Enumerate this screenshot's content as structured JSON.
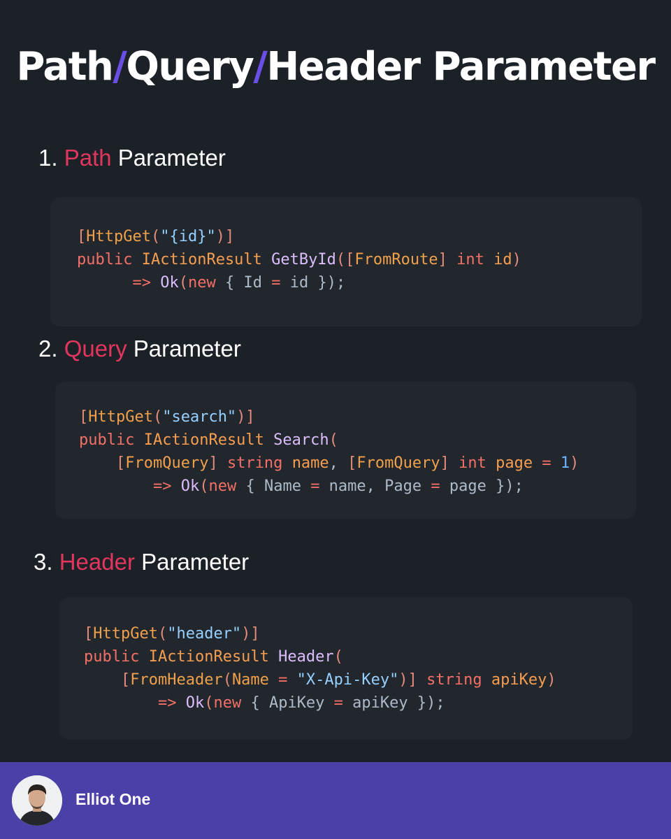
{
  "title": {
    "part1": "Path",
    "sep1": "/",
    "part2": "Query",
    "sep2": "/",
    "part3": "Header Parameter"
  },
  "sections": [
    {
      "number": "1.",
      "keyword": "Path",
      "rest": "Parameter",
      "code": [
        [
          [
            "bracket",
            "["
          ],
          [
            "attr",
            "HttpGet"
          ],
          [
            "bracket",
            "("
          ],
          [
            "str",
            "\"{id}\""
          ],
          [
            "bracket",
            ")]"
          ]
        ],
        [
          [
            "kw",
            "public"
          ],
          [
            "plain",
            " "
          ],
          [
            "type",
            "IActionResult"
          ],
          [
            "plain",
            " "
          ],
          [
            "fn",
            "GetById"
          ],
          [
            "bracket",
            "(["
          ],
          [
            "attr",
            "FromRoute"
          ],
          [
            "bracket",
            "]"
          ],
          [
            "plain",
            " "
          ],
          [
            "kw",
            "int"
          ],
          [
            "plain",
            " "
          ],
          [
            "type",
            "id"
          ],
          [
            "bracket",
            ")"
          ]
        ],
        [
          [
            "plain",
            "      "
          ],
          [
            "kw",
            "=>"
          ],
          [
            "plain",
            " "
          ],
          [
            "fn",
            "Ok"
          ],
          [
            "bracket",
            "("
          ],
          [
            "kw",
            "new"
          ],
          [
            "plain",
            " { Id "
          ],
          [
            "kw",
            "="
          ],
          [
            "plain",
            " id });"
          ]
        ]
      ]
    },
    {
      "number": "2.",
      "keyword": "Query",
      "rest": "Parameter",
      "code": [
        [
          [
            "bracket",
            "["
          ],
          [
            "attr",
            "HttpGet"
          ],
          [
            "bracket",
            "("
          ],
          [
            "str",
            "\"search\""
          ],
          [
            "bracket",
            ")]"
          ]
        ],
        [
          [
            "kw",
            "public"
          ],
          [
            "plain",
            " "
          ],
          [
            "type",
            "IActionResult"
          ],
          [
            "plain",
            " "
          ],
          [
            "fn",
            "Search"
          ],
          [
            "bracket",
            "("
          ]
        ],
        [
          [
            "plain",
            "    "
          ],
          [
            "bracket",
            "["
          ],
          [
            "attr",
            "FromQuery"
          ],
          [
            "bracket",
            "]"
          ],
          [
            "plain",
            " "
          ],
          [
            "kw",
            "string"
          ],
          [
            "plain",
            " "
          ],
          [
            "type",
            "name"
          ],
          [
            "plain",
            ", "
          ],
          [
            "bracket",
            "["
          ],
          [
            "attr",
            "FromQuery"
          ],
          [
            "bracket",
            "]"
          ],
          [
            "plain",
            " "
          ],
          [
            "kw",
            "int"
          ],
          [
            "plain",
            " "
          ],
          [
            "type",
            "page"
          ],
          [
            "plain",
            " "
          ],
          [
            "kw",
            "="
          ],
          [
            "plain",
            " "
          ],
          [
            "num",
            "1"
          ],
          [
            "bracket",
            ")"
          ]
        ],
        [
          [
            "plain",
            "        "
          ],
          [
            "kw",
            "=>"
          ],
          [
            "plain",
            " "
          ],
          [
            "fn",
            "Ok"
          ],
          [
            "bracket",
            "("
          ],
          [
            "kw",
            "new"
          ],
          [
            "plain",
            " { Name "
          ],
          [
            "kw",
            "="
          ],
          [
            "plain",
            " name, Page "
          ],
          [
            "kw",
            "="
          ],
          [
            "plain",
            " page });"
          ]
        ]
      ]
    },
    {
      "number": "3.",
      "keyword": "Header",
      "rest": "Parameter",
      "code": [
        [
          [
            "bracket",
            "["
          ],
          [
            "attr",
            "HttpGet"
          ],
          [
            "bracket",
            "("
          ],
          [
            "str",
            "\"header\""
          ],
          [
            "bracket",
            ")]"
          ]
        ],
        [
          [
            "kw",
            "public"
          ],
          [
            "plain",
            " "
          ],
          [
            "type",
            "IActionResult"
          ],
          [
            "plain",
            " "
          ],
          [
            "fn",
            "Header"
          ],
          [
            "bracket",
            "("
          ]
        ],
        [
          [
            "plain",
            "    "
          ],
          [
            "bracket",
            "["
          ],
          [
            "attr",
            "FromHeader"
          ],
          [
            "bracket",
            "("
          ],
          [
            "attr",
            "Name"
          ],
          [
            "plain",
            " "
          ],
          [
            "kw",
            "="
          ],
          [
            "plain",
            " "
          ],
          [
            "str",
            "\"X-Api-Key\""
          ],
          [
            "bracket",
            ")]"
          ],
          [
            "plain",
            " "
          ],
          [
            "kw",
            "string"
          ],
          [
            "plain",
            " "
          ],
          [
            "type",
            "apiKey"
          ],
          [
            "bracket",
            ")"
          ]
        ],
        [
          [
            "plain",
            "        "
          ],
          [
            "kw",
            "=>"
          ],
          [
            "plain",
            " "
          ],
          [
            "fn",
            "Ok"
          ],
          [
            "bracket",
            "("
          ],
          [
            "kw",
            "new"
          ],
          [
            "plain",
            " { ApiKey "
          ],
          [
            "kw",
            "="
          ],
          [
            "plain",
            " apiKey });"
          ]
        ]
      ]
    }
  ],
  "footer": {
    "author": "Elliot One",
    "avatar_icon": "author-avatar"
  },
  "colors": {
    "background": "#1c2128",
    "code_background": "#22272e",
    "accent_slash": "#6a4fe6",
    "heading_keyword": "#e2365e",
    "footer_band": "#4b3fa8"
  }
}
